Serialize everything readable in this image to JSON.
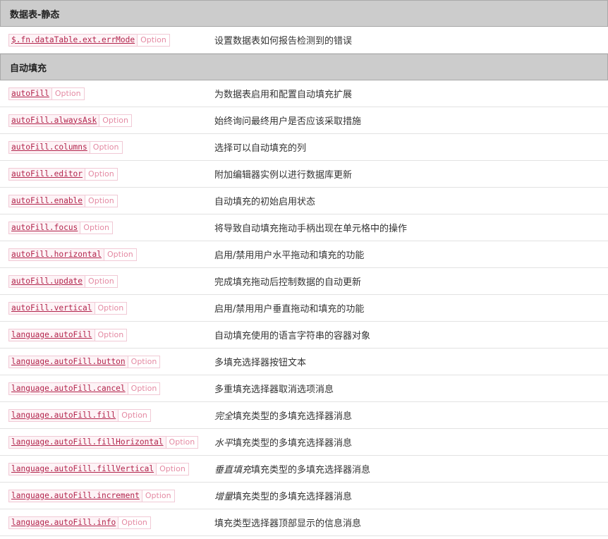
{
  "sections": [
    {
      "title": "数据表-静态",
      "rows": [
        {
          "name": "$.fn.dataTable.ext.errMode",
          "tag": "Option",
          "em": "",
          "desc": "设置数据表如何报告检测到的错误"
        }
      ]
    },
    {
      "title": "自动填充",
      "rows": [
        {
          "name": "autoFill",
          "tag": "Option",
          "em": "",
          "desc": "为数据表启用和配置自动填充扩展"
        },
        {
          "name": "autoFill.alwaysAsk",
          "tag": "Option",
          "em": "",
          "desc": "始终询问最终用户是否应该采取措施"
        },
        {
          "name": "autoFill.columns",
          "tag": "Option",
          "em": "",
          "desc": "选择可以自动填充的列"
        },
        {
          "name": "autoFill.editor",
          "tag": "Option",
          "em": "",
          "desc": "附加编辑器实例以进行数据库更新"
        },
        {
          "name": "autoFill.enable",
          "tag": "Option",
          "em": "",
          "desc": "自动填充的初始启用状态"
        },
        {
          "name": "autoFill.focus",
          "tag": "Option",
          "em": "",
          "desc": "将导致自动填充拖动手柄出现在单元格中的操作"
        },
        {
          "name": "autoFill.horizontal",
          "tag": "Option",
          "em": "",
          "desc": "启用/禁用用户水平拖动和填充的功能"
        },
        {
          "name": "autoFill.update",
          "tag": "Option",
          "em": "",
          "desc": "完成填充拖动后控制数据的自动更新"
        },
        {
          "name": "autoFill.vertical",
          "tag": "Option",
          "em": "",
          "desc": "启用/禁用用户垂直拖动和填充的功能"
        },
        {
          "name": "language.autoFill",
          "tag": "Option",
          "em": "",
          "desc": "自动填充使用的语言字符串的容器对象"
        },
        {
          "name": "language.autoFill.button",
          "tag": "Option",
          "em": "",
          "desc": "多填充选择器按钮文本"
        },
        {
          "name": "language.autoFill.cancel",
          "tag": "Option",
          "em": "",
          "desc": "多重填充选择器取消选项消息"
        },
        {
          "name": "language.autoFill.fill",
          "tag": "Option",
          "em": "完全",
          "desc": "填充类型的多填充选择器消息"
        },
        {
          "name": "language.autoFill.fillHorizontal",
          "tag": "Option",
          "em": "水平",
          "desc": "填充类型的多填充选择器消息"
        },
        {
          "name": "language.autoFill.fillVertical",
          "tag": "Option",
          "em": "垂直填充",
          "desc": "填充类型的多填充选择器消息"
        },
        {
          "name": "language.autoFill.increment",
          "tag": "Option",
          "em": "增量",
          "desc": "填充类型的多填充选择器消息"
        },
        {
          "name": "language.autoFill.info",
          "tag": "Option",
          "em": "",
          "desc": "填充类型选择器顶部显示的信息消息"
        }
      ]
    }
  ]
}
